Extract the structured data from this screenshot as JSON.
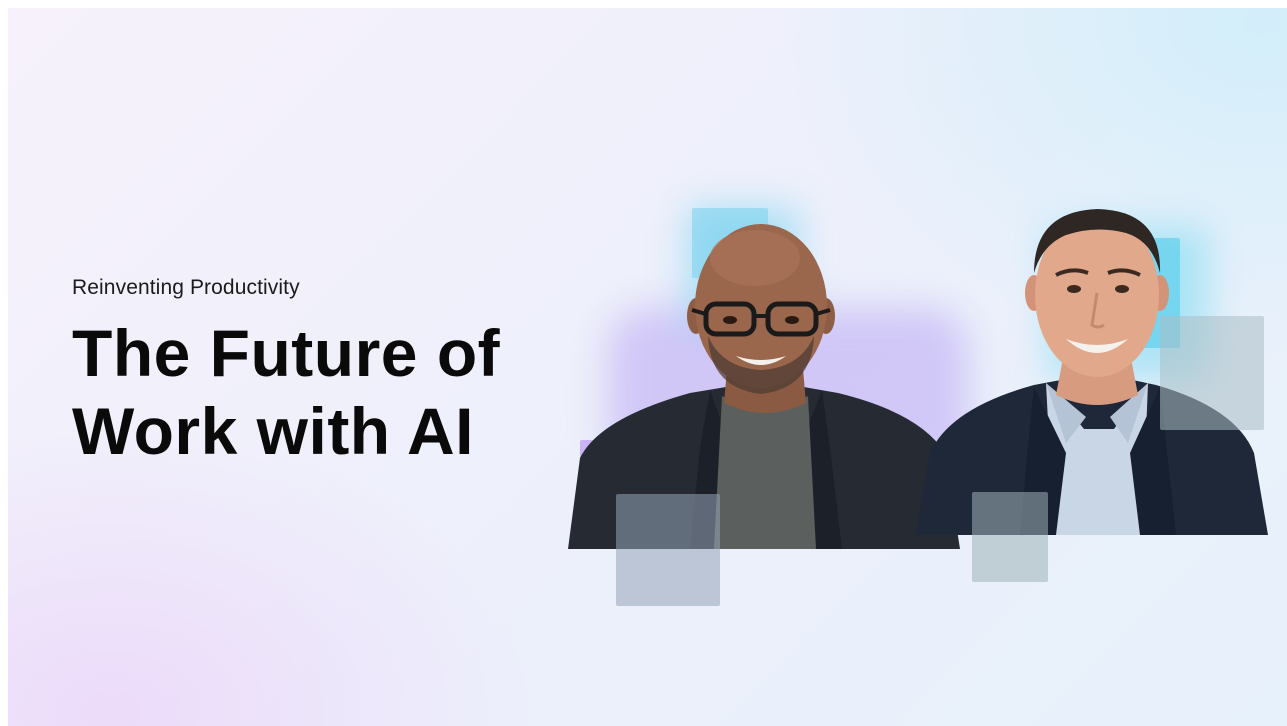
{
  "hero": {
    "eyebrow": "Reinventing Productivity",
    "title_line_1": "The Future of",
    "title_line_2": "Work with AI"
  },
  "speakers": [
    {
      "name": "speaker-left",
      "description": "smiling man with glasses, dark blazer, grey t-shirt"
    },
    {
      "name": "speaker-right",
      "description": "smiling man, dark blazer, light blue shirt"
    }
  ],
  "colors": {
    "headline": "#0a0a0a",
    "accent_cyan": "#7fd9ef",
    "accent_violet": "#b9a6f4",
    "glass_grey": "#9aa8b3"
  }
}
